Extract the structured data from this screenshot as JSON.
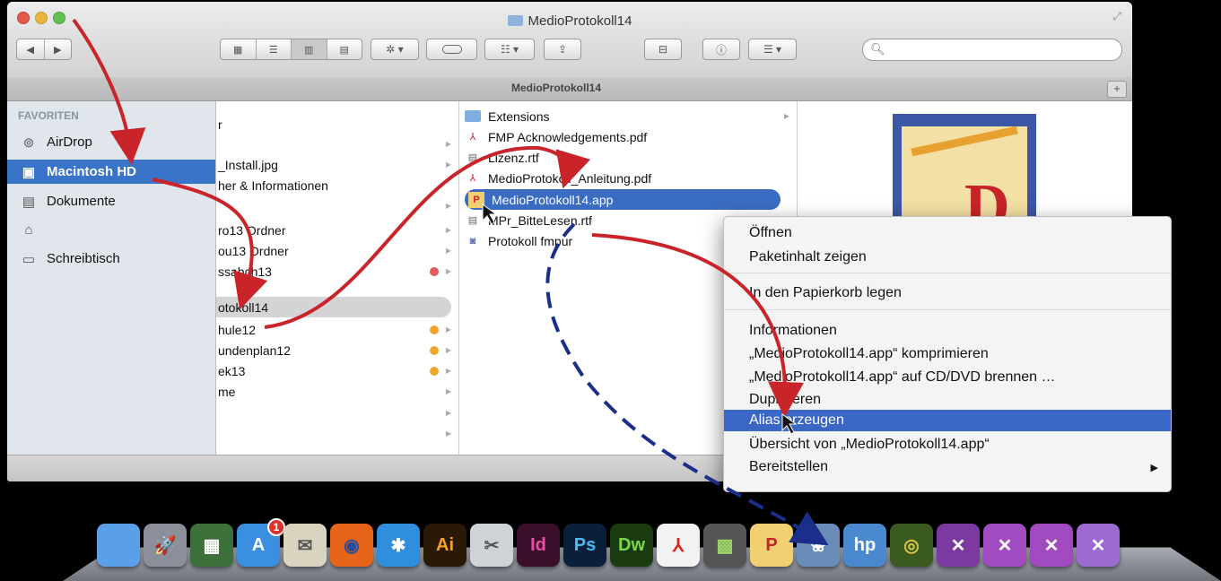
{
  "window": {
    "title": "MedioProtokoll14",
    "tab_title": "MedioProtokoll14",
    "tab_add": "+",
    "search_placeholder": ""
  },
  "toolbar": {
    "back": "◀",
    "forward": "▶",
    "views": [
      "icons-view-icon",
      "list-view-icon",
      "columns-view-icon",
      "coverflow-view-icon"
    ],
    "action": "✲ ▾",
    "tags": "",
    "arrange": "☷ ▾",
    "share": "⇪",
    "connect": "⊟",
    "info": "ⓘ",
    "list_menu": "☰ ▾"
  },
  "sidebar": {
    "heading": "FAVORITEN",
    "items": [
      {
        "label": "AirDrop",
        "icon": "airdrop-icon",
        "selected": false
      },
      {
        "label": "Macintosh HD",
        "icon": "hard-drive-icon",
        "selected": true
      },
      {
        "label": "Dokumente",
        "icon": "documents-icon",
        "selected": false
      },
      {
        "label": "",
        "icon": "home-icon",
        "selected": false
      },
      {
        "label": "Schreibtisch",
        "icon": "desktop-icon",
        "selected": false
      }
    ]
  },
  "column1": {
    "rows": [
      {
        "label": "r",
        "tag": "",
        "selected": false
      },
      {
        "label": "",
        "tag": "",
        "selected": false
      },
      {
        "label": "_Install.jpg",
        "tag": "",
        "selected": false
      },
      {
        "label": "her & Informationen",
        "tag": "",
        "selected": false
      },
      {
        "label": "",
        "tag": "",
        "selected": false
      },
      {
        "label": "ro13 Ordner",
        "tag": "",
        "selected": false
      },
      {
        "label": "ou13 Ordner",
        "tag": "",
        "selected": false
      },
      {
        "label": "ssabch13",
        "tag": "#e25a5a",
        "selected": false
      },
      {
        "label": "otokoll14",
        "tag": "",
        "selected": true
      },
      {
        "label": "hule12",
        "tag": "#f0a530",
        "selected": false
      },
      {
        "label": "undenplan12",
        "tag": "#f0a530",
        "selected": false
      },
      {
        "label": "ek13",
        "tag": "#f0a530",
        "selected": false
      },
      {
        "label": "me",
        "tag": "",
        "selected": false
      },
      {
        "label": "",
        "tag": "",
        "selected": false
      },
      {
        "label": "",
        "tag": "",
        "selected": false
      },
      {
        "label": "",
        "tag": "",
        "selected": false
      }
    ]
  },
  "column2": {
    "rows": [
      {
        "label": "Extensions",
        "icon": "folder-icon",
        "selected": false
      },
      {
        "label": "FMP Acknowledgements.pdf",
        "icon": "pdf-icon",
        "selected": false
      },
      {
        "label": "Lizenz.rtf",
        "icon": "rtf-icon",
        "selected": false
      },
      {
        "label": "MedioProtokoll_Anleitung.pdf",
        "icon": "pdf-icon",
        "selected": false
      },
      {
        "label": "MedioProtokoll14.app",
        "icon": "app-icon",
        "selected": true
      },
      {
        "label": "MPr_BitteLesen.rtf",
        "icon": "rtf-icon",
        "selected": false
      },
      {
        "label": "Protokoll fmpur",
        "icon": "fmp-icon",
        "selected": false
      }
    ]
  },
  "context_menu": {
    "groups": [
      [
        "Öffnen",
        "Paketinhalt zeigen"
      ],
      [
        "In den Papierkorb legen"
      ],
      [
        "Informationen",
        "„MedioProtokoll14.app“ komprimieren",
        "„MedioProtokoll14.app“ auf CD/DVD brennen …",
        "Duplizieren",
        "Alias erzeugen",
        "Übersicht von „MedioProtokoll14.app“",
        "Bereitstellen"
      ]
    ],
    "highlighted": "Alias erzeugen",
    "submenu_arrow": "▶"
  },
  "dock": {
    "icons": [
      {
        "name": "finder-icon",
        "label": "",
        "bg": "#5aa0e8",
        "fg": "#fff"
      },
      {
        "name": "launchpad-icon",
        "label": "🚀",
        "bg": "#8a8f99",
        "fg": "#fff"
      },
      {
        "name": "mission-control-icon",
        "label": "▦",
        "bg": "#3d6f3a",
        "fg": "#fff"
      },
      {
        "name": "app-store-icon",
        "label": "A",
        "bg": "#3a8fe0",
        "fg": "#fff",
        "badge": "1"
      },
      {
        "name": "mail-icon",
        "label": "✉",
        "bg": "#d9d4c0",
        "fg": "#555"
      },
      {
        "name": "firefox-icon",
        "label": "◉",
        "bg": "#e8641a",
        "fg": "#2a4a9e"
      },
      {
        "name": "safari-icon",
        "label": "✱",
        "bg": "#2f8fdc",
        "fg": "#fff"
      },
      {
        "name": "illustrator-icon",
        "label": "Ai",
        "bg": "#2a1a05",
        "fg": "#f7a12c"
      },
      {
        "name": "preview-icon",
        "label": "✂",
        "bg": "#cfd3d8",
        "fg": "#555"
      },
      {
        "name": "indesign-icon",
        "label": "Id",
        "bg": "#3a0f2a",
        "fg": "#e94fa5"
      },
      {
        "name": "photoshop-icon",
        "label": "Ps",
        "bg": "#0a2038",
        "fg": "#4db8f5"
      },
      {
        "name": "dreamweaver-icon",
        "label": "Dw",
        "bg": "#1a3a10",
        "fg": "#7ad64a"
      },
      {
        "name": "acrobat-icon",
        "label": "⅄",
        "bg": "#f2f2f2",
        "fg": "#d9251c"
      },
      {
        "name": "calculator-icon",
        "label": "▩",
        "bg": "#555",
        "fg": "#9ed36a"
      },
      {
        "name": "medioprotokoll-icon",
        "label": "P",
        "bg": "#f0d070",
        "fg": "#c8232a"
      },
      {
        "name": "iphoto-icon",
        "label": "❀",
        "bg": "#6a8cb8",
        "fg": "#fff"
      },
      {
        "name": "hp-utility-icon",
        "label": "hp",
        "bg": "#4a88d0",
        "fg": "#fff"
      },
      {
        "name": "radar-icon",
        "label": "◎",
        "bg": "#3a5a20",
        "fg": "#d6c648"
      },
      {
        "name": "xcode-tools-icon",
        "label": "✕",
        "bg": "#7a3aa0",
        "fg": "#fff"
      },
      {
        "name": "utilities-folder-icon",
        "label": "✕",
        "bg": "#a24ac0",
        "fg": "#fff"
      },
      {
        "name": "utilities-folder-2-icon",
        "label": "✕",
        "bg": "#a24ac0",
        "fg": "#fff"
      },
      {
        "name": "applications-folder-icon",
        "label": "✕",
        "bg": "#9a6ad0",
        "fg": "#fff"
      }
    ]
  },
  "colors": {
    "selection": "#3a67c6",
    "arrow_red": "#c8242a",
    "arrow_blue": "#1a2e8a"
  }
}
